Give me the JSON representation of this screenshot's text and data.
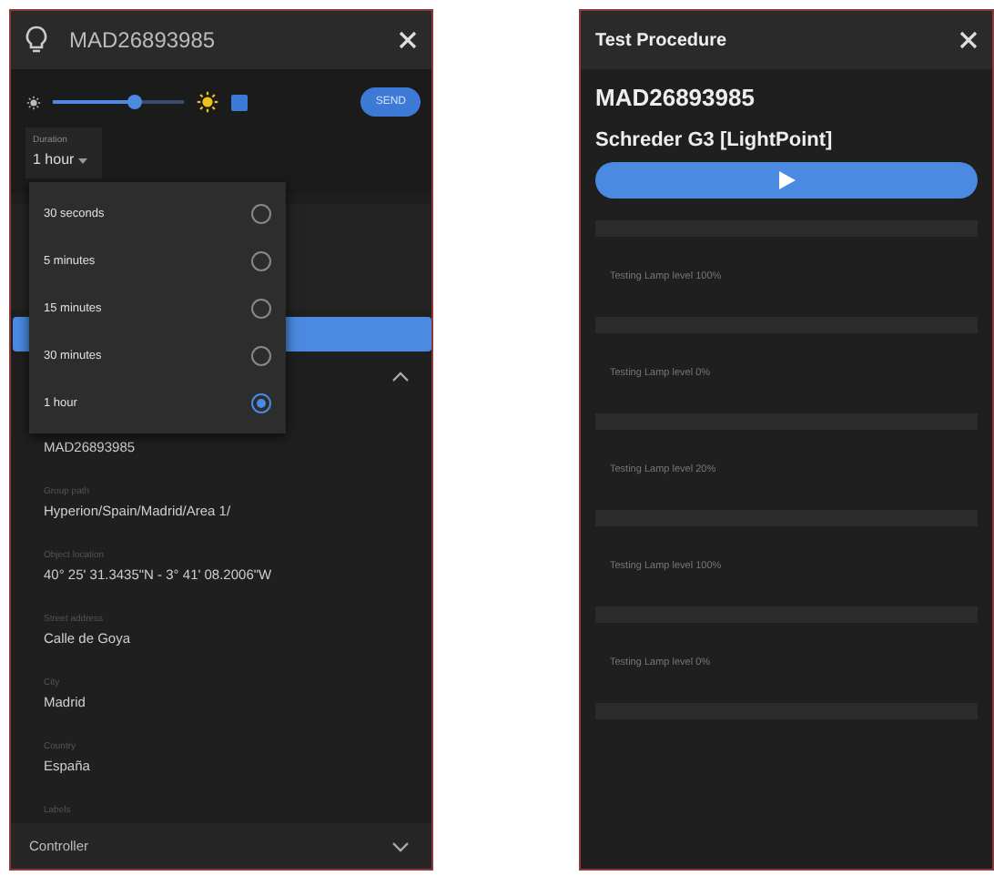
{
  "device_panel": {
    "title": "MAD26893985",
    "brightness": {
      "level": 0.63
    },
    "send_button": "SEND",
    "duration": {
      "label": "Duration",
      "value": "1 hour"
    },
    "duration_menu": [
      {
        "label": "30 seconds",
        "selected": false
      },
      {
        "label": "5 minutes",
        "selected": false
      },
      {
        "label": "15 minutes",
        "selected": false
      },
      {
        "label": "30 minutes",
        "selected": false
      },
      {
        "label": "1 hour",
        "selected": true
      }
    ],
    "details_value": "MAD26893985",
    "fields": [
      {
        "label": "Group path",
        "value": "Hyperion/Spain/Madrid/Area 1/"
      },
      {
        "label": "Object location",
        "value": "40° 25' 31.3435\"N - 3° 41' 08.2006\"W"
      },
      {
        "label": "Street address",
        "value": "Calle de Goya"
      },
      {
        "label": "City",
        "value": "Madrid"
      },
      {
        "label": "Country",
        "value": "España"
      },
      {
        "label": "Labels"
      }
    ],
    "footer": "Controller"
  },
  "test_panel": {
    "title": "Test Procedure",
    "device": "MAD26893985",
    "model": "Schreder G3 [LightPoint]",
    "steps": [
      "Testing Lamp level 100%",
      "Testing Lamp level 0%",
      "Testing Lamp level 20%",
      "Testing Lamp level 100%",
      "Testing Lamp level 0%"
    ]
  }
}
